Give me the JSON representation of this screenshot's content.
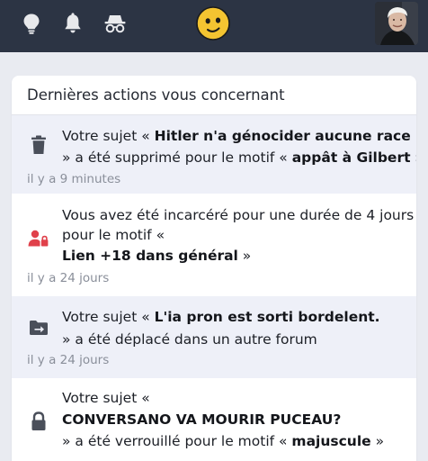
{
  "topbar": {
    "icons": [
      "lightbulb-icon",
      "bell-icon",
      "incognito-icon"
    ],
    "center_emoji": "smiley-emoji",
    "avatar": "user-avatar"
  },
  "card": {
    "title": "Dernières actions vous concernant",
    "notifications": [
      {
        "icon": "trash-icon",
        "line1_prefix": "Votre sujet « ",
        "line1_bold": "Hitler n'a génocider aucune race",
        "line2_prefix": "» a été supprimé pour le motif « ",
        "line2_bold": "appât à Gilbert",
        "line2_suffix": " »",
        "time": "il y a 9 minutes"
      },
      {
        "icon": "user-lock-icon",
        "line1": "Vous avez été incarcéré pour une durée de 4 jours",
        "line2": "pour le motif «",
        "line3_bold": "Lien +18 dans général",
        "line3_suffix": " »",
        "time": "il y a 24 jours",
        "accent": "#e0414b"
      },
      {
        "icon": "folder-move-icon",
        "line1_prefix": "Votre sujet « ",
        "line1_bold": "L'ia pron est sorti bordelent.",
        "line2": "» a été déplacé dans un autre forum",
        "time": "il y a 24 jours"
      },
      {
        "icon": "lock-icon",
        "line1": "Votre sujet «",
        "line2_bold": "CONVERSANO VA MOURIR PUCEAU?",
        "line3_prefix": "» a été verrouillé pour le motif « ",
        "line3_bold": "majuscule",
        "line3_suffix": " »"
      }
    ]
  },
  "colors": {
    "topbar": "#2c3444",
    "page": "#e9ebf1",
    "shaded_row": "#eef0f8",
    "icon_gray": "#4a4f5a",
    "emoji_yellow": "#f4c431"
  }
}
